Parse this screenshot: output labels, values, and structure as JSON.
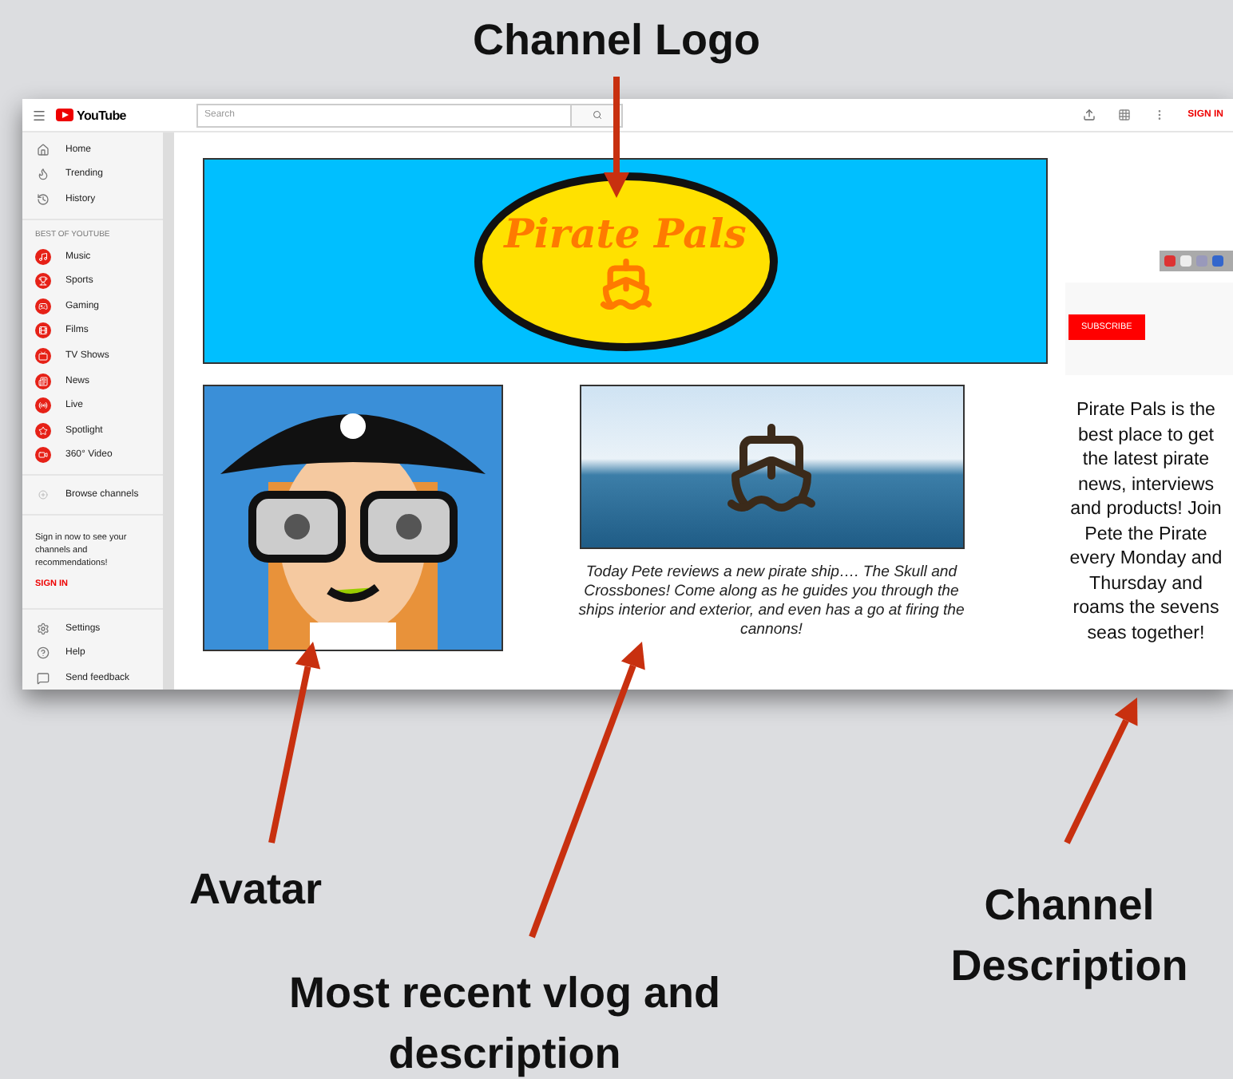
{
  "annotations": [
    {
      "kind": "top",
      "label": "Channel Logo"
    },
    {
      "kind": "avatar",
      "label": "Avatar"
    },
    {
      "kind": "vlog",
      "label": "Most recent vlog and description"
    },
    {
      "kind": "description",
      "label": "Channel Description"
    }
  ],
  "topbar": {
    "logo": "YouTube",
    "search": {
      "placeholder": "Search"
    },
    "sign_in": "SIGN IN"
  },
  "sidebar": {
    "main": [
      "Home",
      "Trending",
      "History"
    ],
    "section_title": "BEST OF YOUTUBE",
    "best": [
      "Music",
      "Sports",
      "Gaming",
      "Films",
      "TV Shows",
      "News",
      "Live",
      "Spotlight",
      "360° Video"
    ],
    "browse": "Browse channels",
    "sign_in_text": "Sign in now to see your channels and recommendations!",
    "sign_in_link": "SIGN IN",
    "footer": [
      "Settings",
      "Help",
      "Send feedback"
    ]
  },
  "banner": {
    "title": "Pirate Pals"
  },
  "video": {
    "caption": "Today Pete reviews a new pirate ship…. The Skull and Crossbones! Come along as he guides you through the ships interior and exterior, and even has a go at firing the cannons!"
  },
  "side": {
    "subscribe": "SUBSCRIBE",
    "description": "Pirate Pals is the best place to get the latest pirate news, interviews and products! Join Pete the Pirate every Monday and Thursday and roams the sevens seas together!"
  }
}
